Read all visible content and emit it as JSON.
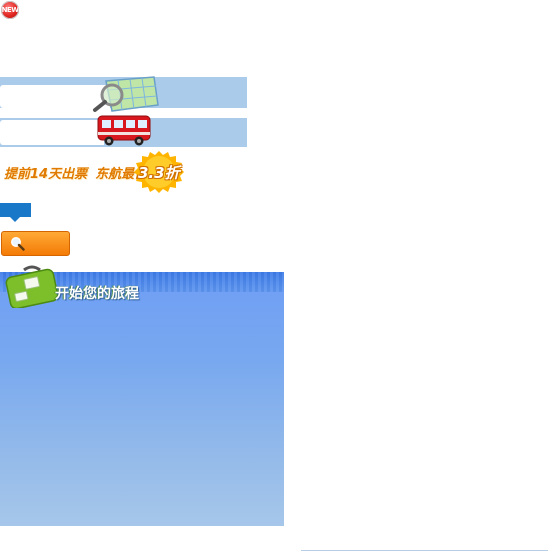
{
  "badge": {
    "label": "NEW"
  },
  "promo": {
    "left_text": "提前14天出票",
    "right_text": "东航最低",
    "discount": "3.3折"
  },
  "journey": {
    "title": "开始您的旅程"
  },
  "colors": {
    "bar_blue": "#aacbea",
    "promo_orange": "#e07a00",
    "button_orange": "#f47b06",
    "panel_blue": "#6f9ef5",
    "tab_blue": "#1a78c8"
  },
  "icons": [
    "new-badge-icon",
    "map-magnifier-icon",
    "bus-icon",
    "discount-sticker-icon",
    "search-icon",
    "travel-bag-icon"
  ]
}
